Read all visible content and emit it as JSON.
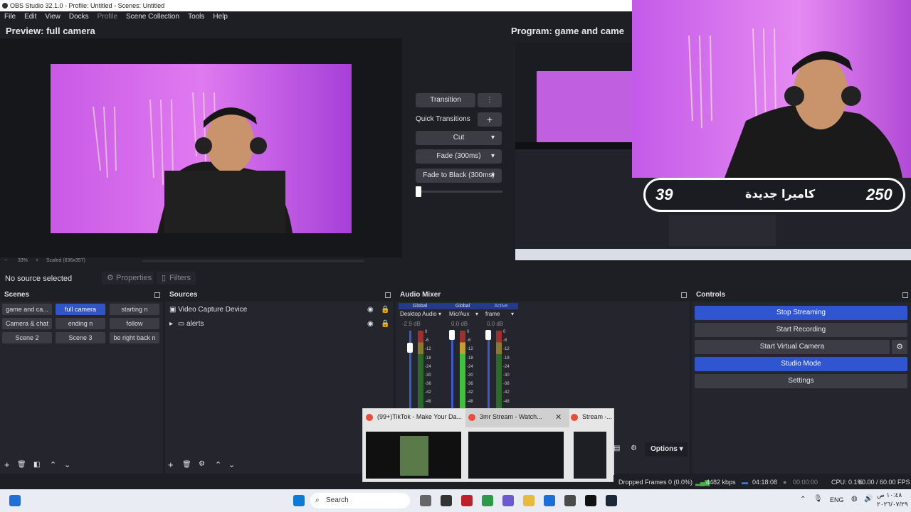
{
  "window": {
    "title": "OBS Studio 32.1.0 - Profile: Untitled - Scenes: Untitled"
  },
  "menu": [
    "File",
    "Edit",
    "View",
    "Docks",
    "Profile",
    "Scene Collection",
    "Tools",
    "Help"
  ],
  "preview": {
    "label": "Preview: full camera",
    "zoom": "33%",
    "scale": "Scaled (636x357)"
  },
  "program": {
    "label": "Program: game and came"
  },
  "transitions": {
    "transition_label": "Transition",
    "quick_label": "Quick Transitions",
    "items": [
      "Cut",
      "Fade (300ms)",
      "Fade to Black (300ms)"
    ]
  },
  "overlay": {
    "left_number": "39",
    "right_number": "250",
    "arabic_text": "كاميرا جديدة"
  },
  "source_bar": {
    "no_source": "No source selected",
    "properties": "Properties",
    "filters": "Filters"
  },
  "scenes": {
    "title": "Scenes",
    "items": [
      "game and ca...",
      "full camera",
      "starting n",
      "Camera & chat",
      "ending n",
      "follow",
      "Scene 2",
      "Scene 3",
      "be right back n"
    ],
    "active_index": 1
  },
  "sources": {
    "title": "Sources",
    "items": [
      "Video Capture Device",
      "alerts"
    ]
  },
  "mixer": {
    "title": "Audio Mixer",
    "channels": [
      {
        "tag": "Global",
        "name": "Desktop Audio",
        "db": "-2.9 dB"
      },
      {
        "tag": "Global",
        "name": "Mic/Aux",
        "db": "0.0 dB"
      },
      {
        "tag": "Active",
        "name": "frame",
        "db": "0.0 dB"
      }
    ],
    "ticks": [
      "0",
      "-6",
      "-12",
      "-18",
      "-24",
      "-30",
      "-36",
      "-42",
      "-48"
    ]
  },
  "controls": {
    "title": "Controls",
    "buttons": [
      "Stop Streaming",
      "Start Recording",
      "Start Virtual Camera",
      "Studio Mode",
      "Settings"
    ],
    "options": "Options"
  },
  "thumbs": [
    {
      "title": "(99+)TikTok - Make Your Da..."
    },
    {
      "title": "3mr Stream - Watch..."
    },
    {
      "title": "Stream -..."
    }
  ],
  "status": {
    "dropped": "Dropped Frames 0 (0.0%)",
    "kbps": "4482 kbps",
    "live_time": "04:18:08",
    "rec_time": "00:00:00",
    "cpu": "CPU: 0.1%",
    "fps": "60.00 / 60.00 FPS"
  },
  "taskbar": {
    "search": "Search",
    "lang": "ENG",
    "time": "١٠:٤٨ ص",
    "date": "٢٠٢٦/٠٧/٢٩"
  },
  "colors": {
    "accent": "#3154c6",
    "bg": "#1e1f25",
    "panel": "#25262d",
    "button": "#3b3c44"
  }
}
